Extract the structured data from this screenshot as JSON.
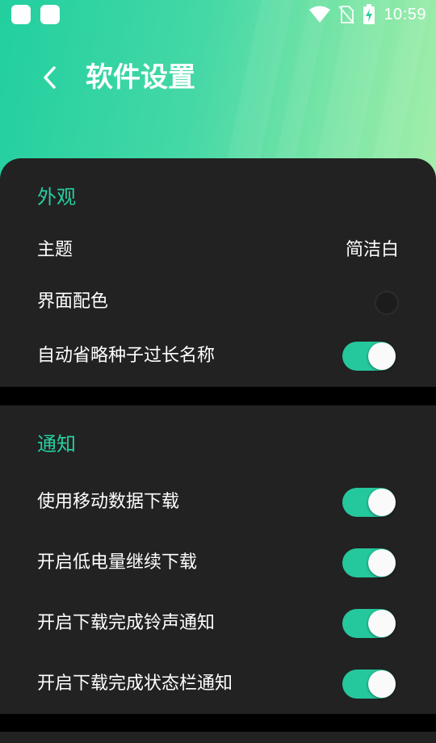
{
  "status_bar": {
    "time": "10:59",
    "icons": [
      "app-notification-icon",
      "app-notification-icon",
      "wifi-icon",
      "no-sim-icon",
      "battery-charging-icon"
    ]
  },
  "header": {
    "title": "软件设置",
    "back_icon": "chevron-left-icon"
  },
  "colors": {
    "accent": "#25cfa0",
    "card_bg": "#222222",
    "text": "#ffffff",
    "toggle_on": "#24c89c"
  },
  "appearance": {
    "section_title": "外观",
    "theme_label": "主题",
    "theme_value": "简洁白",
    "color_label": "界面配色",
    "ellipsis_label": "自动省略种子过长名称",
    "ellipsis_on": true
  },
  "notifications": {
    "section_title": "通知",
    "items": [
      {
        "label": "使用移动数据下载",
        "on": true
      },
      {
        "label": "开启低电量继续下载",
        "on": true
      },
      {
        "label": "开启下载完成铃声通知",
        "on": true
      },
      {
        "label": "开启下载完成状态栏通知",
        "on": true
      }
    ]
  }
}
